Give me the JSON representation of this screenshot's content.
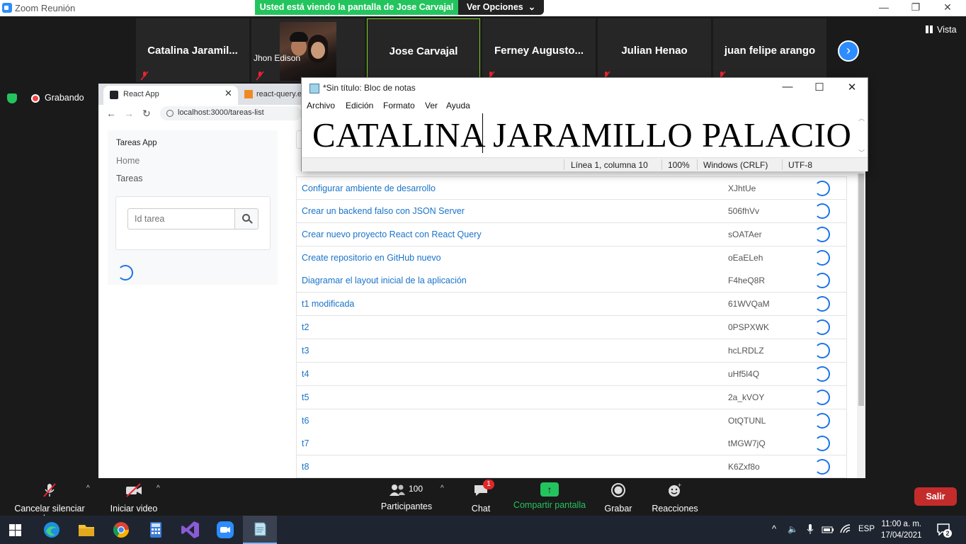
{
  "zoom": {
    "window_title": "Zoom Reunión",
    "share_banner": {
      "viewing": "Usted está viendo la pantalla de Jose Carvajal",
      "options": "Ver Opciones"
    },
    "view_label": "Vista",
    "participants": [
      {
        "name": "Catalina  Jaramil..."
      },
      {
        "name": "Jhon Edison"
      },
      {
        "name": "Jose Carvajal"
      },
      {
        "name": "Ferney  Augusto..."
      },
      {
        "name": "Julian Henao"
      },
      {
        "name": "juan felipe arango"
      }
    ],
    "recording_label": "Grabando",
    "toolbar": {
      "mute": "Cancelar silenciar ahora",
      "video": "Iniciar video",
      "participants": "Participantes",
      "participants_count": "100",
      "chat": "Chat",
      "chat_badge": "1",
      "share": "Compartir pantalla",
      "record": "Grabar",
      "reactions": "Reacciones",
      "leave": "Salir"
    }
  },
  "browser": {
    "tabs": [
      {
        "label": "React App"
      },
      {
        "label": "react-query.es"
      }
    ],
    "url": "localhost:3000/tareas-list"
  },
  "app": {
    "brand": "Tareas App",
    "nav": [
      {
        "label": "Home"
      },
      {
        "label": "Tareas"
      }
    ],
    "search_placeholder": "Id tarea",
    "tasks": [
      {
        "title": "Configurar ambiente de desarrollo",
        "id": "XJhtUe"
      },
      {
        "title": "Crear un backend falso con JSON Server",
        "id": "506fhVv"
      },
      {
        "title": "Crear nuevo proyecto React con React Query",
        "id": "sOATAer"
      },
      {
        "title": "Create repositorio en GitHub nuevo",
        "id": "oEaELeh"
      },
      {
        "title": "Diagramar el layout inicial de la aplicación",
        "id": "F4heQ8R"
      },
      {
        "title": "t1 modificada",
        "id": "61WVQaM"
      },
      {
        "title": "t2",
        "id": "0PSPXWK"
      },
      {
        "title": "t3",
        "id": "hcLRDLZ"
      },
      {
        "title": "t4",
        "id": "uHf5l4Q"
      },
      {
        "title": "t5",
        "id": "2a_kVOY"
      },
      {
        "title": "t6",
        "id": "OtQTUNL"
      },
      {
        "title": "t7",
        "id": "tMGW7jQ"
      },
      {
        "title": "t8",
        "id": "K6Zxf8o"
      }
    ]
  },
  "notepad": {
    "title": "*Sin título: Bloc de notas",
    "menu": [
      {
        "label": "Archivo"
      },
      {
        "label": "Edición"
      },
      {
        "label": "Formato"
      },
      {
        "label": "Ver"
      },
      {
        "label": "Ayuda"
      }
    ],
    "content": "CATALINA JARAMILLO PALACIO",
    "status": {
      "position": "Línea 1, columna 10",
      "zoom": "100%",
      "line_ending": "Windows (CRLF)",
      "encoding": "UTF-8"
    }
  },
  "taskbar": {
    "language": "ESP",
    "time": "11:00 a. m.",
    "date": "17/04/2021",
    "notifications": "2"
  },
  "colors": {
    "zoom_blue": "#2D8CFF",
    "share_green": "#23C45E",
    "leave_red": "#C42C2C",
    "link_blue": "#1A73C8"
  }
}
